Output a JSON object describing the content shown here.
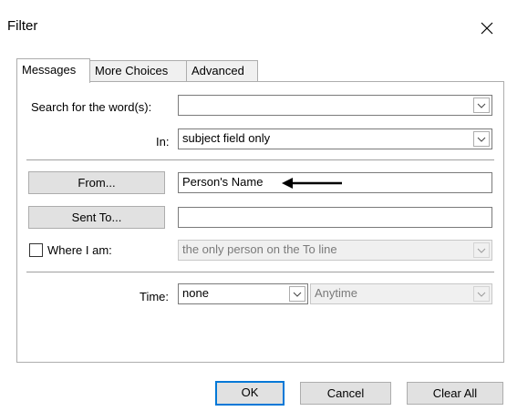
{
  "window": {
    "title": "Filter"
  },
  "tabs": [
    {
      "label": "Messages",
      "active": true
    },
    {
      "label": "More Choices",
      "active": false
    },
    {
      "label": "Advanced",
      "active": false
    }
  ],
  "messages": {
    "search_label": "Search for the word(s):",
    "search_value": "",
    "in_label": "In:",
    "in_value": "subject field only",
    "from_button": "From...",
    "from_value": "Person's Name",
    "sent_to_button": "Sent To...",
    "sent_to_value": "",
    "where_label": "Where I am:",
    "where_checked": false,
    "where_value": "the only person on the To line",
    "time_label": "Time:",
    "time_value": "none",
    "time_range_value": "Anytime"
  },
  "footer": {
    "ok": "OK",
    "cancel": "Cancel",
    "clear_all": "Clear All"
  },
  "icons": {
    "close": "close-icon",
    "dropdown": "chevron-down-icon",
    "annotation": "arrow-left-icon"
  },
  "colors": {
    "accent": "#0078d7",
    "border": "#adadad",
    "button_bg": "#e1e1e1"
  }
}
